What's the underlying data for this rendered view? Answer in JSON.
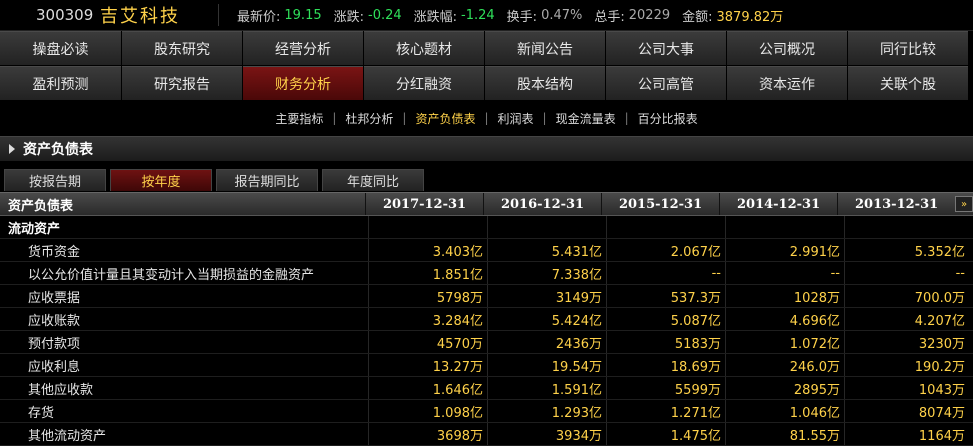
{
  "quote": {
    "code": "300309",
    "name": "吉艾科技",
    "price_label": "最新价:",
    "price": "19.15",
    "change_label": "涨跌:",
    "change": "-0.24",
    "pct_label": "涨跌幅:",
    "pct": "-1.24",
    "turnover_label": "换手:",
    "turnover": "0.47%",
    "volume_label": "总手:",
    "volume": "20229",
    "amount_label": "金额:",
    "amount": "3879.82万"
  },
  "nav": {
    "row1": [
      "操盘必读",
      "股东研究",
      "经营分析",
      "核心题材",
      "新闻公告",
      "公司大事",
      "公司概况",
      "同行比较"
    ],
    "row2": [
      "盈利预测",
      "研究报告",
      "财务分析",
      "分红融资",
      "股本结构",
      "公司高管",
      "资本运作",
      "关联个股"
    ],
    "active": "财务分析"
  },
  "submenu": [
    "主要指标",
    "杜邦分析",
    "资产负债表",
    "利润表",
    "现金流量表",
    "百分比报表"
  ],
  "submenu_active": "资产负债表",
  "section_title": "资产负债表",
  "tabs": [
    "按报告期",
    "按年度",
    "报告期同比",
    "年度同比"
  ],
  "tab_active": "按年度",
  "table": {
    "header_label": "资产负债表",
    "columns": [
      "2017-12-31",
      "2016-12-31",
      "2015-12-31",
      "2014-12-31",
      "2013-12-31"
    ],
    "more_icon": "»",
    "group": "流动资产",
    "rows": [
      {
        "label": "货币资金",
        "values": [
          "3.403亿",
          "5.431亿",
          "2.067亿",
          "2.991亿",
          "5.352亿"
        ]
      },
      {
        "label": "以公允价值计量且其变动计入当期损益的金融资产",
        "values": [
          "1.851亿",
          "7.338亿",
          "--",
          "--",
          "--"
        ]
      },
      {
        "label": "应收票据",
        "values": [
          "5798万",
          "3149万",
          "537.3万",
          "1028万",
          "700.0万"
        ]
      },
      {
        "label": "应收账款",
        "values": [
          "3.284亿",
          "5.424亿",
          "5.087亿",
          "4.696亿",
          "4.207亿"
        ]
      },
      {
        "label": "预付款项",
        "values": [
          "4570万",
          "2436万",
          "5183万",
          "1.072亿",
          "3230万"
        ]
      },
      {
        "label": "应收利息",
        "values": [
          "13.27万",
          "19.54万",
          "18.69万",
          "246.0万",
          "190.2万"
        ]
      },
      {
        "label": "其他应收款",
        "values": [
          "1.646亿",
          "1.591亿",
          "5599万",
          "2895万",
          "1043万"
        ]
      },
      {
        "label": "存货",
        "values": [
          "1.098亿",
          "1.293亿",
          "1.271亿",
          "1.046亿",
          "8074万"
        ]
      },
      {
        "label": "其他流动资产",
        "values": [
          "3698万",
          "3934万",
          "1.475亿",
          "81.55万",
          "1164万"
        ]
      }
    ]
  }
}
